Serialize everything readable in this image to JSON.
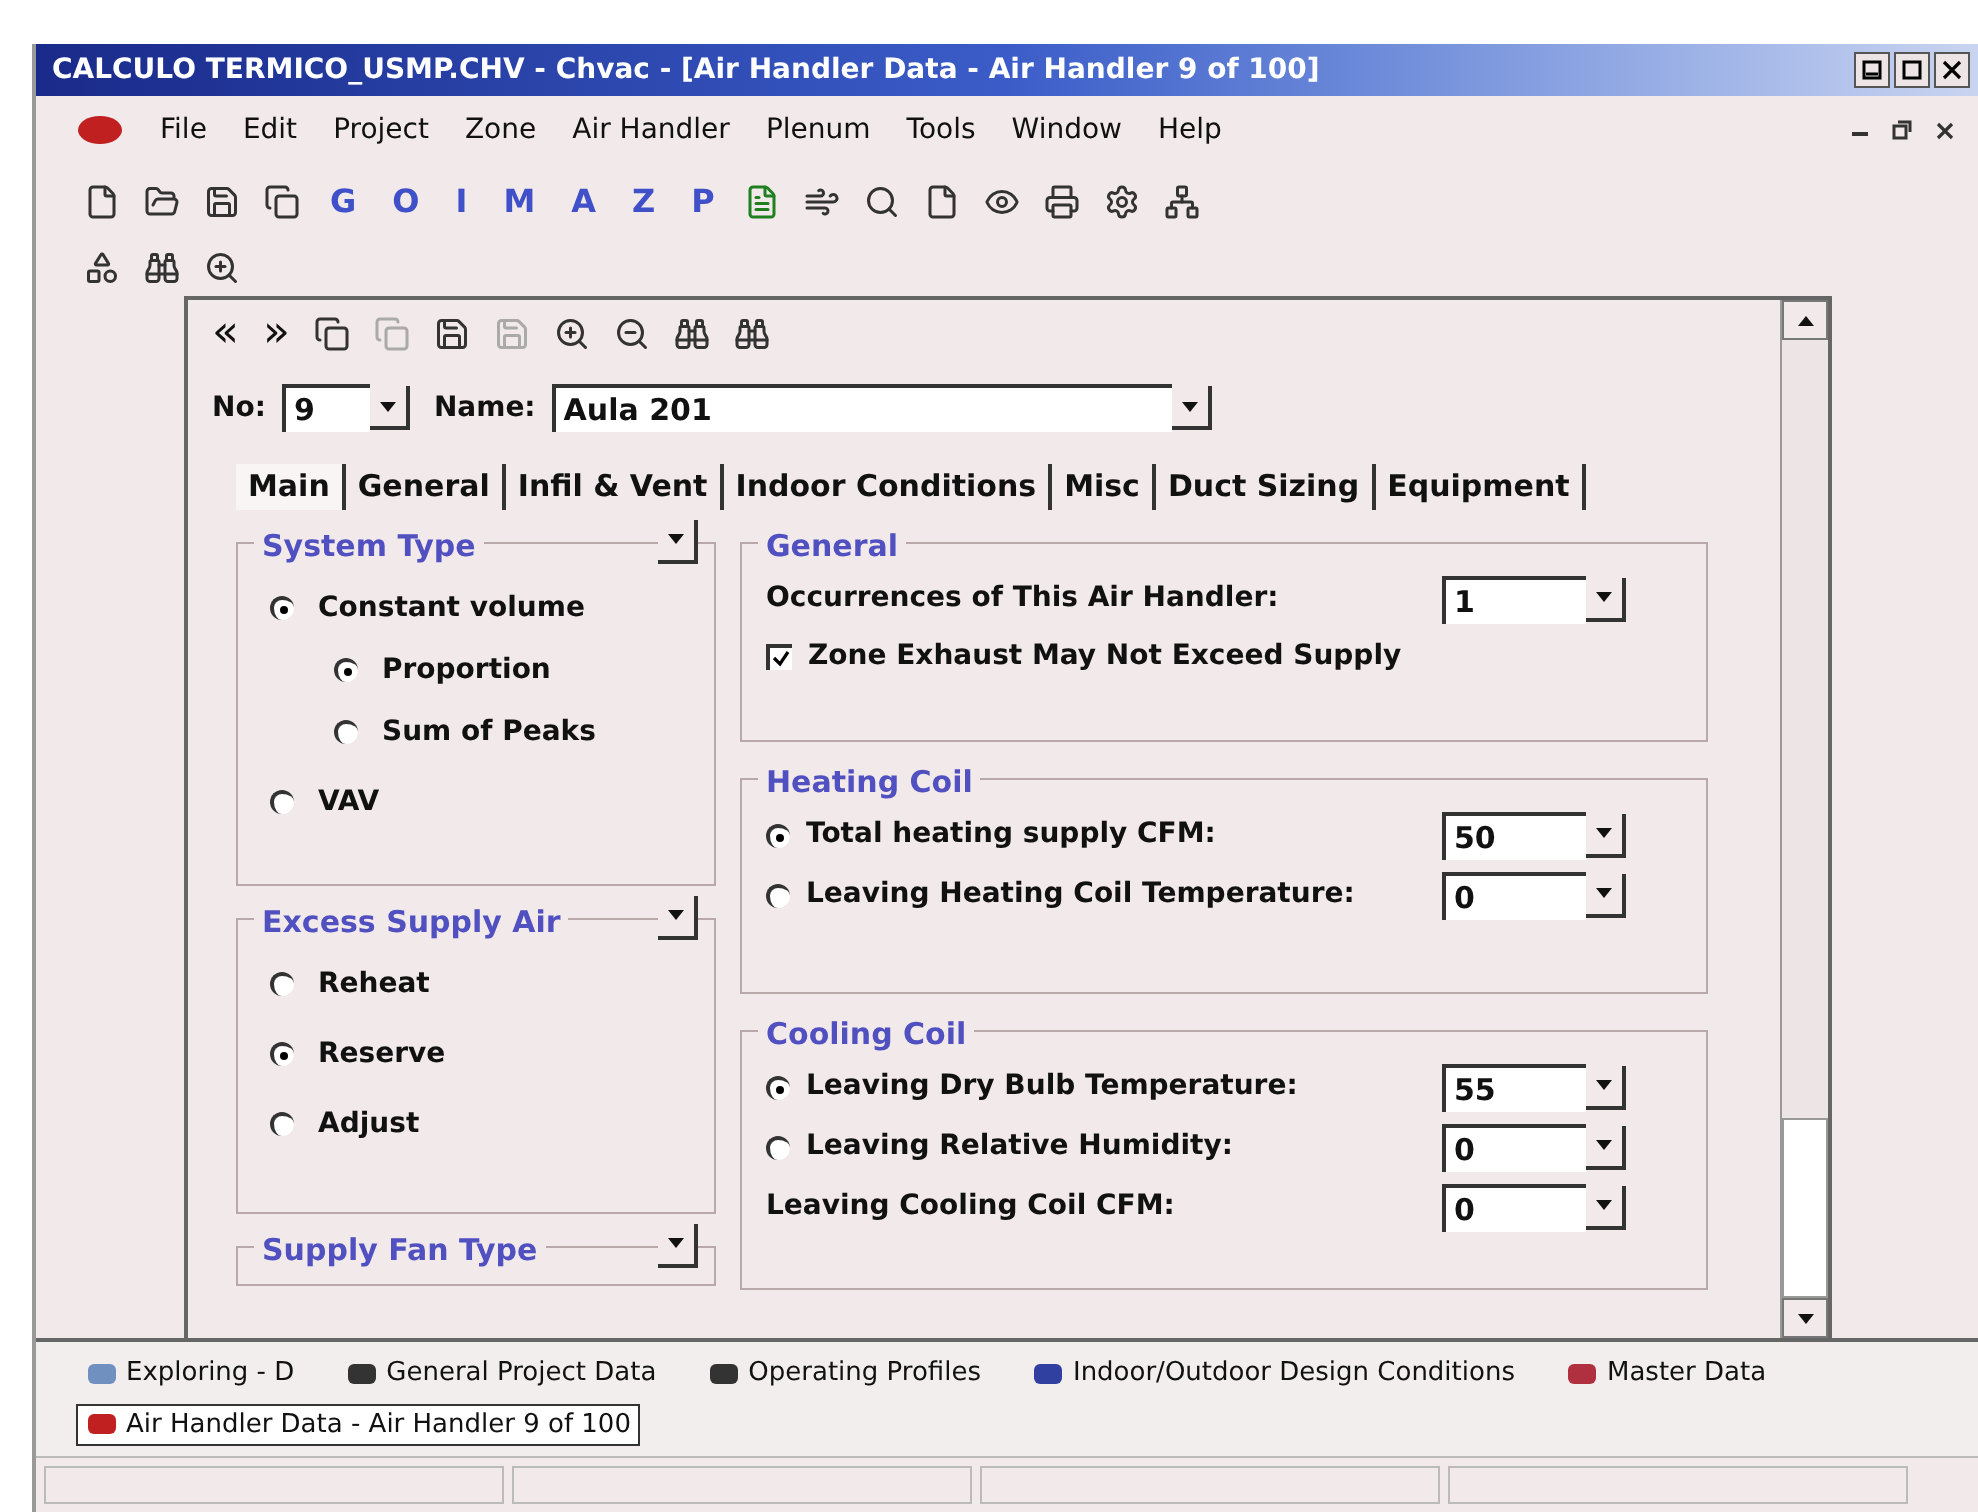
{
  "window": {
    "title": "CALCULO TERMICO_USMP.CHV - Chvac - [Air Handler Data - Air Handler 9 of 100]"
  },
  "menu": [
    "File",
    "Edit",
    "Project",
    "Zone",
    "Air Handler",
    "Plenum",
    "Tools",
    "Window",
    "Help"
  ],
  "toolbar_letters": [
    "G",
    "O",
    "I",
    "M",
    "A",
    "Z",
    "P"
  ],
  "child": {
    "nav": [
      "«",
      "»"
    ],
    "no_field": {
      "label": "No:",
      "value": "9"
    },
    "name_field": {
      "label": "Name:",
      "value": "Aula 201"
    },
    "tabs": [
      {
        "label": "Main",
        "selected": true
      },
      {
        "label": "General",
        "selected": false
      },
      {
        "label": "Infil & Vent",
        "selected": false
      },
      {
        "label": "Indoor Conditions",
        "selected": false
      },
      {
        "label": "Misc",
        "selected": false
      },
      {
        "label": "Duct Sizing",
        "selected": false
      },
      {
        "label": "Equipment",
        "selected": false
      }
    ],
    "left_groups": [
      {
        "title": "System Type",
        "options": [
          {
            "label": "Constant volume",
            "selected": true,
            "children": [
              {
                "label": "Proportion",
                "selected": true
              },
              {
                "label": "Sum of Peaks",
                "selected": false
              }
            ]
          },
          {
            "label": "VAV",
            "selected": false
          }
        ]
      },
      {
        "title": "Excess Supply Air",
        "options": [
          {
            "label": "Reheat",
            "selected": false
          },
          {
            "label": "Reserve",
            "selected": true
          },
          {
            "label": "Adjust",
            "selected": false
          }
        ]
      },
      {
        "title": "Supply Fan Type"
      }
    ],
    "right_groups": [
      {
        "title": "General",
        "rows": [
          {
            "kind": "field",
            "label": "Occurrences of This Air Handler:",
            "value": "1"
          },
          {
            "kind": "checkbox",
            "label": "Zone Exhaust May Not Exceed Supply",
            "checked": true
          }
        ]
      },
      {
        "title": "Heating Coil",
        "rows": [
          {
            "kind": "radio",
            "label": "Total heating supply CFM:",
            "value": "50",
            "selected": true
          },
          {
            "kind": "radio",
            "label": "Leaving Heating Coil Temperature:",
            "value": "0",
            "selected": false
          }
        ]
      },
      {
        "title": "Cooling Coil",
        "rows": [
          {
            "kind": "radio",
            "label": "Leaving Dry Bulb Temperature:",
            "value": "55",
            "selected": true
          },
          {
            "kind": "radio",
            "label": "Leaving Relative Humidity:",
            "value": "0",
            "selected": false
          },
          {
            "kind": "field",
            "label": "Leaving Cooling Coil CFM:",
            "value": "0"
          }
        ]
      }
    ]
  },
  "taskbar": [
    {
      "label": "Exploring - D",
      "selected": false
    },
    {
      "label": "General Project Data",
      "selected": false
    },
    {
      "label": "Operating Profiles",
      "selected": false
    },
    {
      "label": "Indoor/Outdoor Design Conditions",
      "selected": false
    },
    {
      "label": "Master Data",
      "selected": false
    },
    {
      "label": "Air Handler Data - Air Handler 9 of 100",
      "selected": true
    }
  ]
}
